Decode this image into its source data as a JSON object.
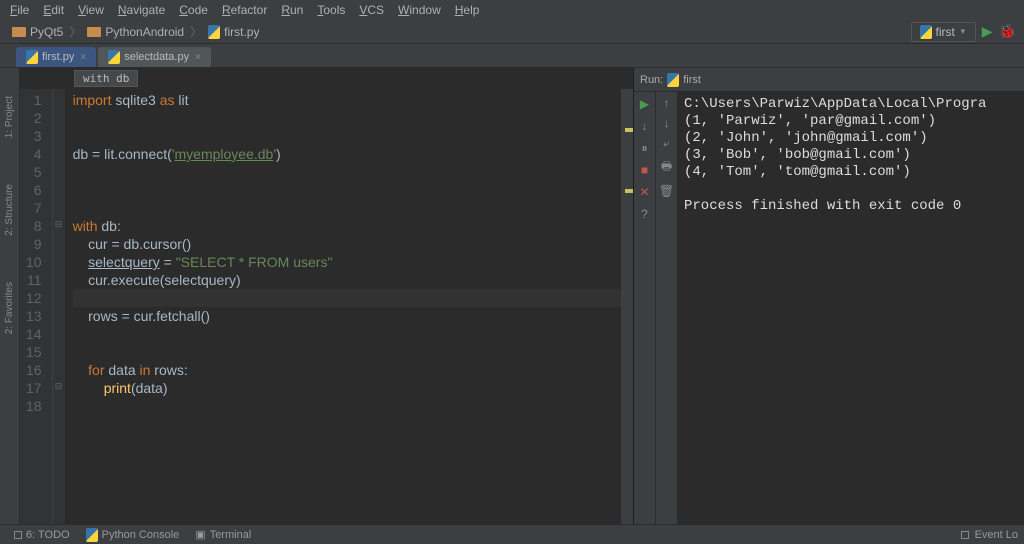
{
  "menu": [
    "File",
    "Edit",
    "View",
    "Navigate",
    "Code",
    "Refactor",
    "Run",
    "Tools",
    "VCS",
    "Window",
    "Help"
  ],
  "breadcrumbs": {
    "folder": "PyQt5",
    "sub": "PythonAndroid",
    "file": "first.py"
  },
  "run_config": {
    "name": "first"
  },
  "tabs": [
    {
      "name": "first.py",
      "active": true
    },
    {
      "name": "selectdata.py",
      "active": false
    }
  ],
  "context_hint": "with db",
  "side_tools": [
    "1: Project",
    "2: Structure",
    "2: Favorites"
  ],
  "gutter": [
    1,
    2,
    3,
    4,
    5,
    6,
    7,
    8,
    9,
    10,
    11,
    12,
    13,
    14,
    15,
    16,
    17,
    18
  ],
  "code": [
    {
      "type": "code",
      "html": "<span class='kw'>import</span> sqlite3 <span class='kw'>as</span> lit"
    },
    {
      "type": "blank"
    },
    {
      "type": "blank"
    },
    {
      "type": "code",
      "html": "db = lit.connect(<span class='str'>'</span><span class='strb'>myemployee.db</span><span class='str'>'</span>)"
    },
    {
      "type": "blank"
    },
    {
      "type": "blank"
    },
    {
      "type": "blank"
    },
    {
      "type": "code",
      "html": "<span class='kw'>with</span> db:"
    },
    {
      "type": "code",
      "html": "    cur = db.cursor()"
    },
    {
      "type": "code",
      "html": "    <span style='text-decoration:underline'>selectquery</span> = <span class='str'>\"SELECT * FROM users\"</span>"
    },
    {
      "type": "code",
      "html": "    cur.execute(selectquery)"
    },
    {
      "type": "blank",
      "hl": true
    },
    {
      "type": "code",
      "html": "    rows = cur.fetchall()"
    },
    {
      "type": "blank"
    },
    {
      "type": "blank"
    },
    {
      "type": "code",
      "html": "    <span class='kw'>for</span> data <span class='kw'>in</span> rows:"
    },
    {
      "type": "code",
      "html": "        <span class='fn'>print</span>(data)"
    },
    {
      "type": "blank"
    }
  ],
  "marks": [
    9,
    23
  ],
  "run": {
    "label": "Run:",
    "config": "first",
    "toolbar1": [
      {
        "name": "play",
        "glyph": "▶",
        "color": "#499c54"
      },
      {
        "name": "rerun",
        "glyph": "↓",
        "color": "#888"
      },
      {
        "name": "pause",
        "glyph": "⏸",
        "color": "#888"
      },
      {
        "name": "stop",
        "glyph": "■",
        "color": "#c75450"
      },
      {
        "name": "close",
        "glyph": "✕",
        "color": "#c75450"
      },
      {
        "name": "help",
        "glyph": "?",
        "color": "#888"
      }
    ],
    "toolbar2": [
      {
        "name": "up",
        "glyph": "↑",
        "color": "#888"
      },
      {
        "name": "down",
        "glyph": "↓",
        "color": "#888"
      },
      {
        "name": "wrap",
        "glyph": "⤶",
        "color": "#888"
      },
      {
        "name": "print",
        "glyph": "🖶",
        "color": "#888"
      },
      {
        "name": "trash",
        "glyph": "🗑",
        "color": "#888"
      }
    ],
    "output": "C:\\Users\\Parwiz\\AppData\\Local\\Progra\n(1, 'Parwiz', 'par@gmail.com')\n(2, 'John', 'john@gmail.com')\n(3, 'Bob', 'bob@gmail.com')\n(4, 'Tom', 'tom@gmail.com')\n\nProcess finished with exit code 0"
  },
  "bottom": {
    "tabs": [
      {
        "name": "6: TODO",
        "icon": "sq"
      },
      {
        "name": "Python Console",
        "icon": "py"
      },
      {
        "name": "Terminal",
        "icon": "term"
      }
    ],
    "right": "Event Lo"
  }
}
